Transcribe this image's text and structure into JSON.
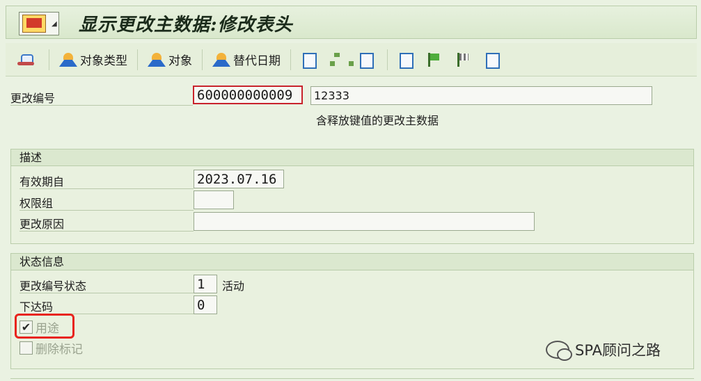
{
  "window": {
    "title": "显示更改主数据:修改表头"
  },
  "toolbar": {
    "object_type_label": "对象类型",
    "object_label": "对象",
    "alt_date_label": "替代日期"
  },
  "header": {
    "change_number_label": "更改编号",
    "change_number_value": "600000000009",
    "description_value": "12333",
    "note": "含释放键值的更改主数据"
  },
  "desc_group": {
    "title": "描述",
    "valid_from_label": "有效期自",
    "valid_from_value": "2023.07.16",
    "auth_group_label": "权限组",
    "auth_group_value": "",
    "reason_label": "更改原因",
    "reason_value": ""
  },
  "status_group": {
    "title": "状态信息",
    "status_label": "更改编号状态",
    "status_value": "1",
    "status_text": "活动",
    "release_label": "下达码",
    "release_value": "0",
    "usage_label": "用途",
    "usage_checked": true,
    "delete_label": "删除标记",
    "delete_checked": false
  },
  "watermark": {
    "text": "SPA顾问之路"
  },
  "colors": {
    "accent_red": "#e8241e",
    "background": "#eaf2e2"
  }
}
